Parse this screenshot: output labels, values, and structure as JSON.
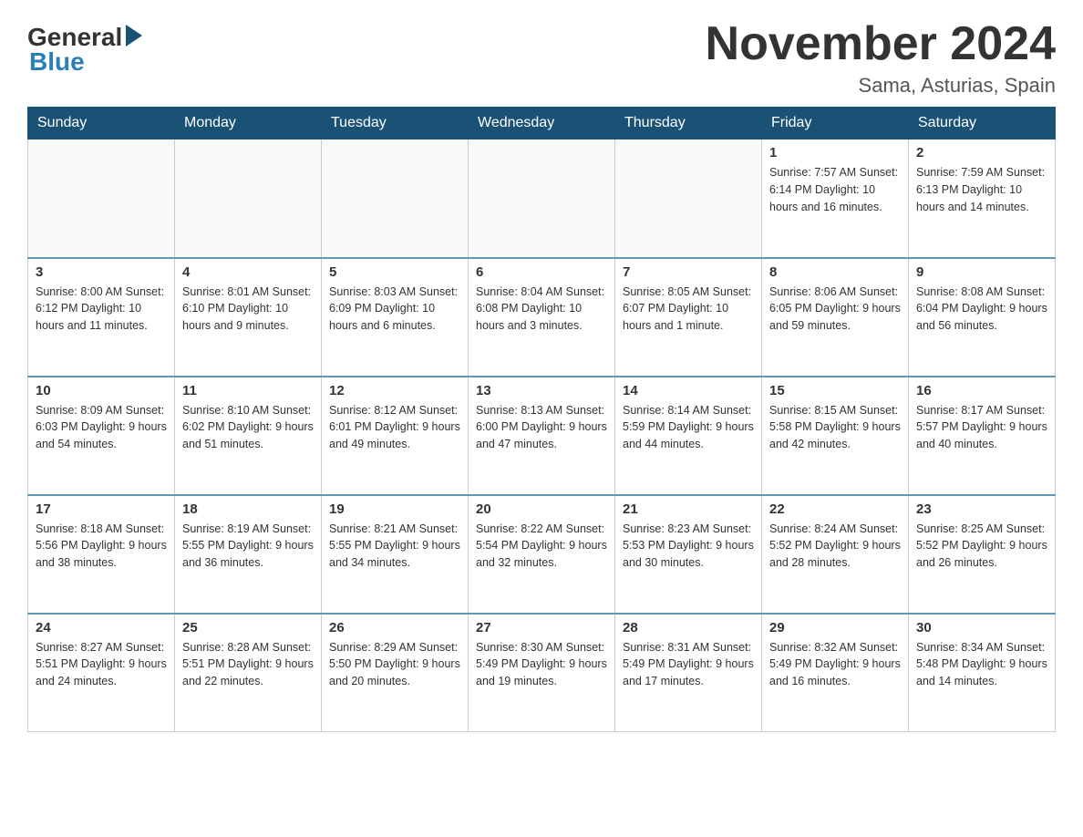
{
  "header": {
    "logo_text": "General",
    "logo_blue": "Blue",
    "month_title": "November 2024",
    "location": "Sama, Asturias, Spain"
  },
  "weekdays": [
    "Sunday",
    "Monday",
    "Tuesday",
    "Wednesday",
    "Thursday",
    "Friday",
    "Saturday"
  ],
  "weeks": [
    [
      {
        "day": "",
        "info": ""
      },
      {
        "day": "",
        "info": ""
      },
      {
        "day": "",
        "info": ""
      },
      {
        "day": "",
        "info": ""
      },
      {
        "day": "",
        "info": ""
      },
      {
        "day": "1",
        "info": "Sunrise: 7:57 AM\nSunset: 6:14 PM\nDaylight: 10 hours\nand 16 minutes."
      },
      {
        "day": "2",
        "info": "Sunrise: 7:59 AM\nSunset: 6:13 PM\nDaylight: 10 hours\nand 14 minutes."
      }
    ],
    [
      {
        "day": "3",
        "info": "Sunrise: 8:00 AM\nSunset: 6:12 PM\nDaylight: 10 hours\nand 11 minutes."
      },
      {
        "day": "4",
        "info": "Sunrise: 8:01 AM\nSunset: 6:10 PM\nDaylight: 10 hours\nand 9 minutes."
      },
      {
        "day": "5",
        "info": "Sunrise: 8:03 AM\nSunset: 6:09 PM\nDaylight: 10 hours\nand 6 minutes."
      },
      {
        "day": "6",
        "info": "Sunrise: 8:04 AM\nSunset: 6:08 PM\nDaylight: 10 hours\nand 3 minutes."
      },
      {
        "day": "7",
        "info": "Sunrise: 8:05 AM\nSunset: 6:07 PM\nDaylight: 10 hours\nand 1 minute."
      },
      {
        "day": "8",
        "info": "Sunrise: 8:06 AM\nSunset: 6:05 PM\nDaylight: 9 hours\nand 59 minutes."
      },
      {
        "day": "9",
        "info": "Sunrise: 8:08 AM\nSunset: 6:04 PM\nDaylight: 9 hours\nand 56 minutes."
      }
    ],
    [
      {
        "day": "10",
        "info": "Sunrise: 8:09 AM\nSunset: 6:03 PM\nDaylight: 9 hours\nand 54 minutes."
      },
      {
        "day": "11",
        "info": "Sunrise: 8:10 AM\nSunset: 6:02 PM\nDaylight: 9 hours\nand 51 minutes."
      },
      {
        "day": "12",
        "info": "Sunrise: 8:12 AM\nSunset: 6:01 PM\nDaylight: 9 hours\nand 49 minutes."
      },
      {
        "day": "13",
        "info": "Sunrise: 8:13 AM\nSunset: 6:00 PM\nDaylight: 9 hours\nand 47 minutes."
      },
      {
        "day": "14",
        "info": "Sunrise: 8:14 AM\nSunset: 5:59 PM\nDaylight: 9 hours\nand 44 minutes."
      },
      {
        "day": "15",
        "info": "Sunrise: 8:15 AM\nSunset: 5:58 PM\nDaylight: 9 hours\nand 42 minutes."
      },
      {
        "day": "16",
        "info": "Sunrise: 8:17 AM\nSunset: 5:57 PM\nDaylight: 9 hours\nand 40 minutes."
      }
    ],
    [
      {
        "day": "17",
        "info": "Sunrise: 8:18 AM\nSunset: 5:56 PM\nDaylight: 9 hours\nand 38 minutes."
      },
      {
        "day": "18",
        "info": "Sunrise: 8:19 AM\nSunset: 5:55 PM\nDaylight: 9 hours\nand 36 minutes."
      },
      {
        "day": "19",
        "info": "Sunrise: 8:21 AM\nSunset: 5:55 PM\nDaylight: 9 hours\nand 34 minutes."
      },
      {
        "day": "20",
        "info": "Sunrise: 8:22 AM\nSunset: 5:54 PM\nDaylight: 9 hours\nand 32 minutes."
      },
      {
        "day": "21",
        "info": "Sunrise: 8:23 AM\nSunset: 5:53 PM\nDaylight: 9 hours\nand 30 minutes."
      },
      {
        "day": "22",
        "info": "Sunrise: 8:24 AM\nSunset: 5:52 PM\nDaylight: 9 hours\nand 28 minutes."
      },
      {
        "day": "23",
        "info": "Sunrise: 8:25 AM\nSunset: 5:52 PM\nDaylight: 9 hours\nand 26 minutes."
      }
    ],
    [
      {
        "day": "24",
        "info": "Sunrise: 8:27 AM\nSunset: 5:51 PM\nDaylight: 9 hours\nand 24 minutes."
      },
      {
        "day": "25",
        "info": "Sunrise: 8:28 AM\nSunset: 5:51 PM\nDaylight: 9 hours\nand 22 minutes."
      },
      {
        "day": "26",
        "info": "Sunrise: 8:29 AM\nSunset: 5:50 PM\nDaylight: 9 hours\nand 20 minutes."
      },
      {
        "day": "27",
        "info": "Sunrise: 8:30 AM\nSunset: 5:49 PM\nDaylight: 9 hours\nand 19 minutes."
      },
      {
        "day": "28",
        "info": "Sunrise: 8:31 AM\nSunset: 5:49 PM\nDaylight: 9 hours\nand 17 minutes."
      },
      {
        "day": "29",
        "info": "Sunrise: 8:32 AM\nSunset: 5:49 PM\nDaylight: 9 hours\nand 16 minutes."
      },
      {
        "day": "30",
        "info": "Sunrise: 8:34 AM\nSunset: 5:48 PM\nDaylight: 9 hours\nand 14 minutes."
      }
    ]
  ]
}
